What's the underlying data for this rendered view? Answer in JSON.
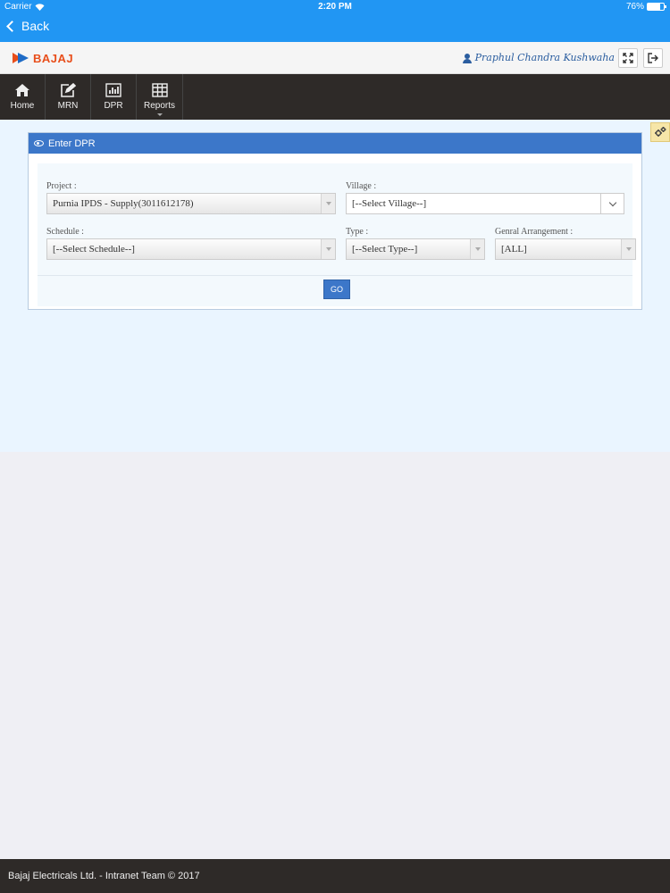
{
  "status_bar": {
    "carrier": "Carrier",
    "time": "2:20 PM",
    "battery": "76%",
    "battery_level": 0.76
  },
  "nav": {
    "back_label": "Back"
  },
  "header": {
    "brand": "BAJAJ",
    "user_name": "Praphul Chandra Kushwaha"
  },
  "menu": [
    {
      "label": "Home",
      "icon": "home-icon"
    },
    {
      "label": "MRN",
      "icon": "edit-icon"
    },
    {
      "label": "DPR",
      "icon": "bar-chart-icon"
    },
    {
      "label": "Reports",
      "icon": "table-icon"
    }
  ],
  "panel": {
    "title": "Enter DPR",
    "project": {
      "label": "Project :",
      "value": "Purnia IPDS - Supply(3011612178)"
    },
    "village": {
      "label": "Village :",
      "value": "[--Select Village--]"
    },
    "schedule": {
      "label": "Schedule :",
      "value": "[--Select Schedule--]"
    },
    "type": {
      "label": "Type :",
      "value": "[--Select Type--]"
    },
    "genral": {
      "label": "Genral Arrangement :",
      "value": "[ALL]"
    },
    "go_label": "GO"
  },
  "footer": {
    "text": "Bajaj Electricals Ltd. - Intranet Team © 2017"
  },
  "colors": {
    "ios_blue": "#2196f3",
    "dark_nav": "#2e2a28",
    "panel_blue": "#3c77c9",
    "brand_orange": "#e84e1b"
  }
}
